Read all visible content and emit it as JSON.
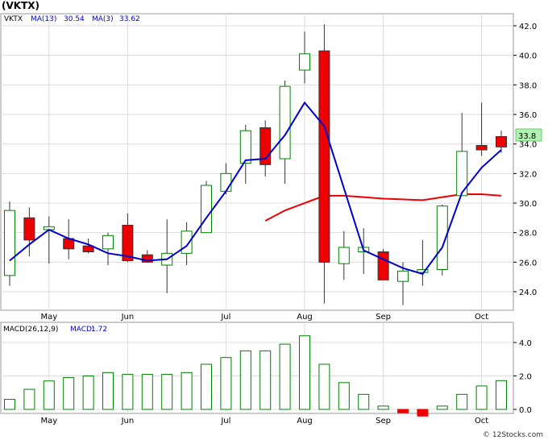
{
  "title": "(VKTX)",
  "watermark": "© 12Stocks.com",
  "colors": {
    "up_fill": "#ffffff",
    "up_stroke": "#008000",
    "down_fill": "#ee0000",
    "ma13": "#0000cc",
    "ma3": "#ee0000",
    "macd": "#008000",
    "last_badge": "#b3f0b3"
  },
  "chart_data": [
    {
      "type": "candlestick",
      "legend": {
        "ticker": "VKTX",
        "ma13_label": "MA(13)",
        "ma13_value": "30.54",
        "ma3_label": "MA(3)",
        "ma3_value": "33.62"
      },
      "last_price_label": "33.8",
      "ylim": [
        22.6,
        43.0
      ],
      "yticks": [
        "24.0",
        "26.0",
        "28.0",
        "30.0",
        "32.0",
        "34.0",
        "36.0",
        "38.0",
        "40.0",
        "42.0"
      ],
      "xticks": [
        {
          "i": 2,
          "label": "May"
        },
        {
          "i": 6,
          "label": "Jun"
        },
        {
          "i": 11,
          "label": "Jul"
        },
        {
          "i": 15,
          "label": "Aug"
        },
        {
          "i": 19,
          "label": "Sep"
        },
        {
          "i": 24,
          "label": "Oct"
        }
      ],
      "candles": [
        {
          "o": 25.1,
          "h": 30.1,
          "l": 24.4,
          "c": 29.5
        },
        {
          "o": 29.0,
          "h": 29.7,
          "l": 26.4,
          "c": 27.5
        },
        {
          "o": 28.2,
          "h": 29.1,
          "l": 25.9,
          "c": 28.4
        },
        {
          "o": 27.6,
          "h": 28.9,
          "l": 26.2,
          "c": 26.9
        },
        {
          "o": 27.1,
          "h": 27.6,
          "l": 26.6,
          "c": 26.7
        },
        {
          "o": 26.9,
          "h": 28.0,
          "l": 25.8,
          "c": 27.8
        },
        {
          "o": 28.5,
          "h": 29.3,
          "l": 26.0,
          "c": 26.1
        },
        {
          "o": 26.5,
          "h": 26.8,
          "l": 26.0,
          "c": 26.0
        },
        {
          "o": 25.8,
          "h": 28.9,
          "l": 23.9,
          "c": 26.6
        },
        {
          "o": 26.6,
          "h": 28.7,
          "l": 25.8,
          "c": 28.1
        },
        {
          "o": 28.0,
          "h": 31.5,
          "l": 28.0,
          "c": 31.2
        },
        {
          "o": 30.8,
          "h": 32.7,
          "l": 30.6,
          "c": 32.0
        },
        {
          "o": 32.7,
          "h": 35.3,
          "l": 31.3,
          "c": 34.9
        },
        {
          "o": 35.1,
          "h": 35.6,
          "l": 31.8,
          "c": 32.6
        },
        {
          "o": 33.0,
          "h": 38.3,
          "l": 31.3,
          "c": 37.9
        },
        {
          "o": 39.0,
          "h": 41.6,
          "l": 38.1,
          "c": 40.1
        },
        {
          "o": 40.3,
          "h": 42.1,
          "l": 23.2,
          "c": 26.0
        },
        {
          "o": 25.9,
          "h": 28.1,
          "l": 24.8,
          "c": 27.0
        },
        {
          "o": 26.7,
          "h": 28.3,
          "l": 25.2,
          "c": 27.0
        },
        {
          "o": 26.7,
          "h": 26.9,
          "l": 24.8,
          "c": 24.8
        },
        {
          "o": 24.7,
          "h": 26.0,
          "l": 23.1,
          "c": 25.4
        },
        {
          "o": 25.3,
          "h": 27.5,
          "l": 24.4,
          "c": 25.5
        },
        {
          "o": 25.5,
          "h": 29.9,
          "l": 25.1,
          "c": 29.8
        },
        {
          "o": 30.5,
          "h": 36.1,
          "l": 30.5,
          "c": 33.5
        },
        {
          "o": 33.9,
          "h": 36.8,
          "l": 33.2,
          "c": 33.6
        },
        {
          "o": 34.5,
          "h": 34.9,
          "l": 33.4,
          "c": 33.8
        }
      ],
      "ma13": [
        null,
        null,
        null,
        null,
        null,
        null,
        null,
        null,
        null,
        null,
        null,
        null,
        null,
        28.8,
        29.5,
        null,
        30.5,
        30.5,
        30.4,
        30.3,
        null,
        30.2,
        30.4,
        30.6,
        30.6,
        30.5
      ],
      "ma3": [
        26.1,
        27.2,
        28.2,
        27.6,
        27.2,
        26.6,
        26.4,
        26.1,
        26.2,
        27.1,
        29.0,
        30.8,
        32.9,
        33.0,
        34.6,
        36.8,
        35.2,
        31.0,
        26.8,
        26.2,
        25.6,
        25.2,
        27.0,
        30.7,
        32.4,
        33.6
      ]
    },
    {
      "type": "bar",
      "legend": {
        "label": "MACD(26,12,9)",
        "value_label": "MACD:",
        "value": "1.72"
      },
      "ylim": [
        -0.3,
        5.0
      ],
      "yticks": [
        "0.0",
        "2.0",
        "4.0"
      ],
      "xticks": [
        {
          "i": 2,
          "label": "May"
        },
        {
          "i": 6,
          "label": "Jun"
        },
        {
          "i": 11,
          "label": "Jul"
        },
        {
          "i": 15,
          "label": "Aug"
        },
        {
          "i": 19,
          "label": "Sep"
        },
        {
          "i": 24,
          "label": "Oct"
        }
      ],
      "values": [
        0.6,
        1.2,
        1.7,
        1.9,
        2.0,
        2.2,
        2.1,
        2.1,
        2.1,
        2.2,
        2.7,
        3.1,
        3.5,
        3.5,
        3.9,
        4.4,
        2.7,
        1.6,
        0.9,
        0.2,
        -0.2,
        -0.4,
        0.2,
        0.9,
        1.4,
        1.72
      ]
    }
  ]
}
